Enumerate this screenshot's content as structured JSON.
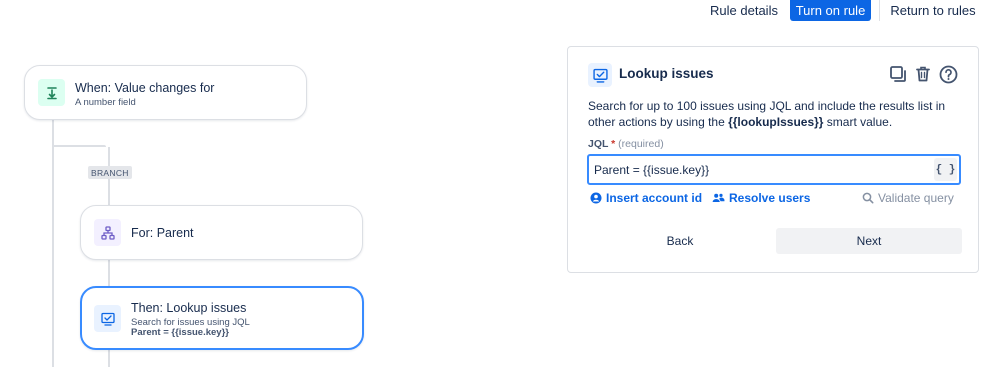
{
  "topbar": {
    "rule_details": "Rule details",
    "turn_on_rule": "Turn on rule",
    "return_to_rules": "Return to rules"
  },
  "canvas": {
    "trigger": {
      "title": "When: Value changes for",
      "subtitle": "A number field",
      "icon": "field-change-icon",
      "icon_color": "#1f845a"
    },
    "branch_label": "BRANCH",
    "branch_node": {
      "title": "For: Parent",
      "icon": "hierarchy-icon",
      "icon_color": "#6e5dc6"
    },
    "action": {
      "title": "Then: Lookup issues",
      "subtitle": "Search for issues using JQL",
      "detail": "Parent = {{issue.key}}",
      "icon": "lookup-issues-icon",
      "icon_color": "#0c66e4"
    }
  },
  "panel": {
    "title": "Lookup issues",
    "description_pre": "Search for up to 100 issues using JQL and include the results list in other actions by using the ",
    "description_bold": "{{lookupIssues}}",
    "description_post": " smart value.",
    "jql_label": "JQL",
    "jql_required": "(required)",
    "jql_value": "Parent = {{issue.key}}",
    "smart_value_button": "{ }",
    "insert_account_id": "Insert account id",
    "resolve_users": "Resolve users",
    "validate_query": "Validate query",
    "back": "Back",
    "next": "Next"
  },
  "colors": {
    "primary": "#0c66e4",
    "selected_border": "#388bff",
    "connector": "#dcdfe4"
  }
}
